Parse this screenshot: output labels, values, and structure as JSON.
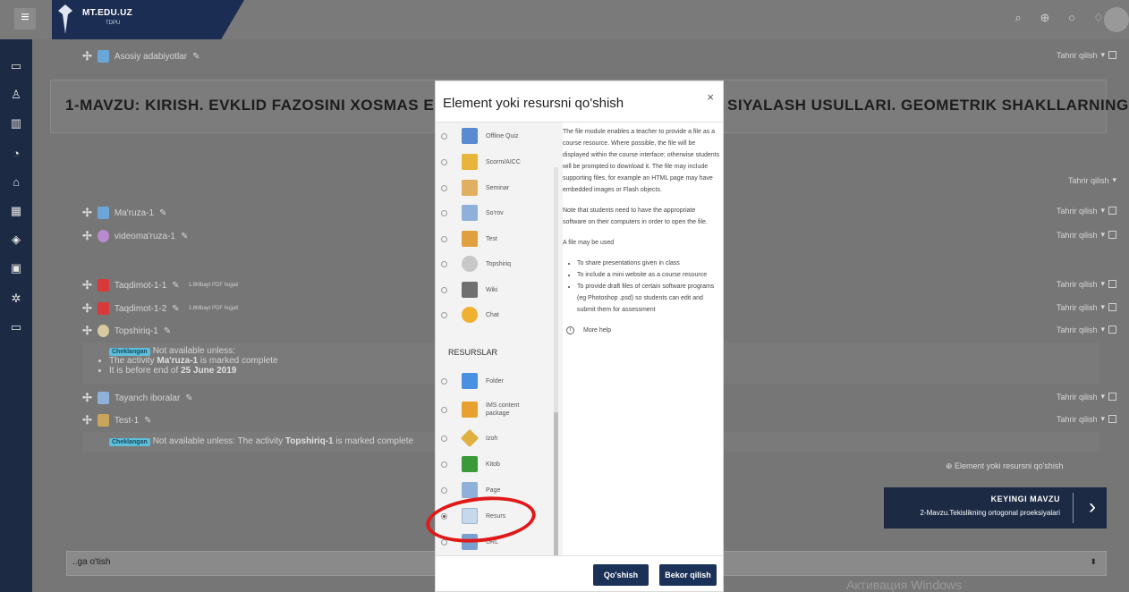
{
  "brand": {
    "name": "MT.EDU.UZ",
    "sub": "TDPU"
  },
  "header": {
    "icons": [
      "search-icon",
      "globe-icon",
      "chat-icon",
      "bell-icon"
    ]
  },
  "sidebar": {
    "icons": [
      "course-icon",
      "participants-icon",
      "badges-icon",
      "competencies-icon",
      "home-icon",
      "calendar-icon",
      "graduation-icon",
      "files-icon",
      "settings-icon",
      "courses-icon"
    ]
  },
  "top_row": {
    "label": "Asosiy adabiyotlar",
    "edit": "Tahrir qilish"
  },
  "add_link": "Element yoki resursni qo'shish",
  "topic": {
    "title": "1-MAVZU: KIRISH. EVKLID FAZOSINI XOSMAS EL",
    "title_tail": "SIYALASH USULLARI. GEOMETRIK SHAKLLARNING"
  },
  "edit_section": "Tahrir qilish",
  "activities": [
    {
      "label": "Ma'ruza-1",
      "meta": "",
      "edit": "Tahrir qilish",
      "icon": "folder-icon",
      "color": "#6aa6d8"
    },
    {
      "label": "videoma'ruza-1",
      "meta": "",
      "edit": "Tahrir qilish",
      "icon": "video-icon",
      "color": "#b88ad0"
    },
    {
      "label": "Taqdimot-1-1",
      "meta": "1.8Mbayt PDF hujjati",
      "edit": "Tahrir qilish",
      "icon": "pdf-icon",
      "color": "#d83a3a"
    },
    {
      "label": "Taqdimot-1-2",
      "meta": "1.8Mbayt PDF hujjati",
      "edit": "Tahrir qilish",
      "icon": "pdf-icon",
      "color": "#d83a3a"
    },
    {
      "label": "Topshiriq-1",
      "meta": "",
      "edit": "Tahrir qilish",
      "icon": "assignment-icon",
      "color": "#d9c9a0"
    },
    {
      "label": "Tayanch iboralar",
      "meta": "",
      "edit": "Tahrir qilish",
      "icon": "page-icon",
      "color": "#8fb0d8"
    },
    {
      "label": "Test-1",
      "meta": "",
      "edit": "Tahrir qilish",
      "icon": "quiz-icon",
      "color": "#c8a55a"
    }
  ],
  "restriction1": {
    "tag": "Cheklangan",
    "text": "Not available unless:",
    "bullet1_pre": "The activity ",
    "bullet1_bold": "Ma'ruza-1",
    "bullet1_post": " is marked complete",
    "bullet2_pre": "It is before end of ",
    "bullet2_bold": "25 June 2019"
  },
  "restriction2": {
    "tag": "Cheklangan",
    "pre": "Not available unless: The activity ",
    "bold": "Topshiriq-1",
    "post": " is marked complete"
  },
  "next_topic": {
    "label": "KEYINGI MAVZU",
    "name": "2-Mavzu.Tekislikning ortogonal proeksiyalari"
  },
  "jump": {
    "value": "..ga o'tish"
  },
  "watermark": "Активация Windows",
  "modal": {
    "title": "Element yoki resursni qo'shish",
    "close": "×",
    "items_top": [
      {
        "label": "Offline Quiz",
        "icon": "offline-quiz-icon",
        "color": "#5a8bd0"
      },
      {
        "label": "Scorm/AICC",
        "icon": "scorm-icon",
        "color": "#e8b43a"
      },
      {
        "label": "Seminar",
        "icon": "seminar-icon",
        "color": "#e0b060"
      },
      {
        "label": "So'rov",
        "icon": "survey-icon",
        "color": "#8fb0d8"
      },
      {
        "label": "Test",
        "icon": "quiz-icon",
        "color": "#e0a040"
      },
      {
        "label": "Topshiriq",
        "icon": "assignment-icon",
        "color": "#c8c8c8"
      },
      {
        "label": "Wiki",
        "icon": "wiki-icon",
        "color": "#707070"
      },
      {
        "label": "Chat",
        "icon": "chat-icon",
        "color": "#f0b030"
      }
    ],
    "section": "RESURSLAR",
    "items_res": [
      {
        "label": "Folder",
        "icon": "folder-icon",
        "color": "#4a90e2"
      },
      {
        "label": "IMS content package",
        "icon": "ims-icon",
        "color": "#e8a030"
      },
      {
        "label": "Izoh",
        "icon": "label-icon",
        "color": "#e0b040"
      },
      {
        "label": "Kitob",
        "icon": "book-icon",
        "color": "#3a9a3a"
      },
      {
        "label": "Page",
        "icon": "page-icon",
        "color": "#8fb0d8"
      },
      {
        "label": "Resurs",
        "icon": "file-icon",
        "color": "#c8d8ec"
      },
      {
        "label": "URL",
        "icon": "url-icon",
        "color": "#7aa0d0"
      }
    ],
    "desc_p1": "The file module enables a teacher to provide a file as a course resource. Where possible, the file will be displayed within the course interface; otherwise students will be prompted to download it. The file may include supporting files, for example an HTML page may have embedded images or Flash objects.",
    "desc_p2": "Note that students need to have the appropriate software on their computers in order to open the file.",
    "desc_p3": "A file may be used",
    "desc_b1": "To share presentations given in class",
    "desc_b2": "To include a mini website as a course resource",
    "desc_b3": "To provide draft files of certain software programs (eg Photoshop .psd) so students can edit and submit them for assessment",
    "more_help": "More help",
    "add_btn": "Qo'shish",
    "cancel_btn": "Bekor qilish"
  }
}
